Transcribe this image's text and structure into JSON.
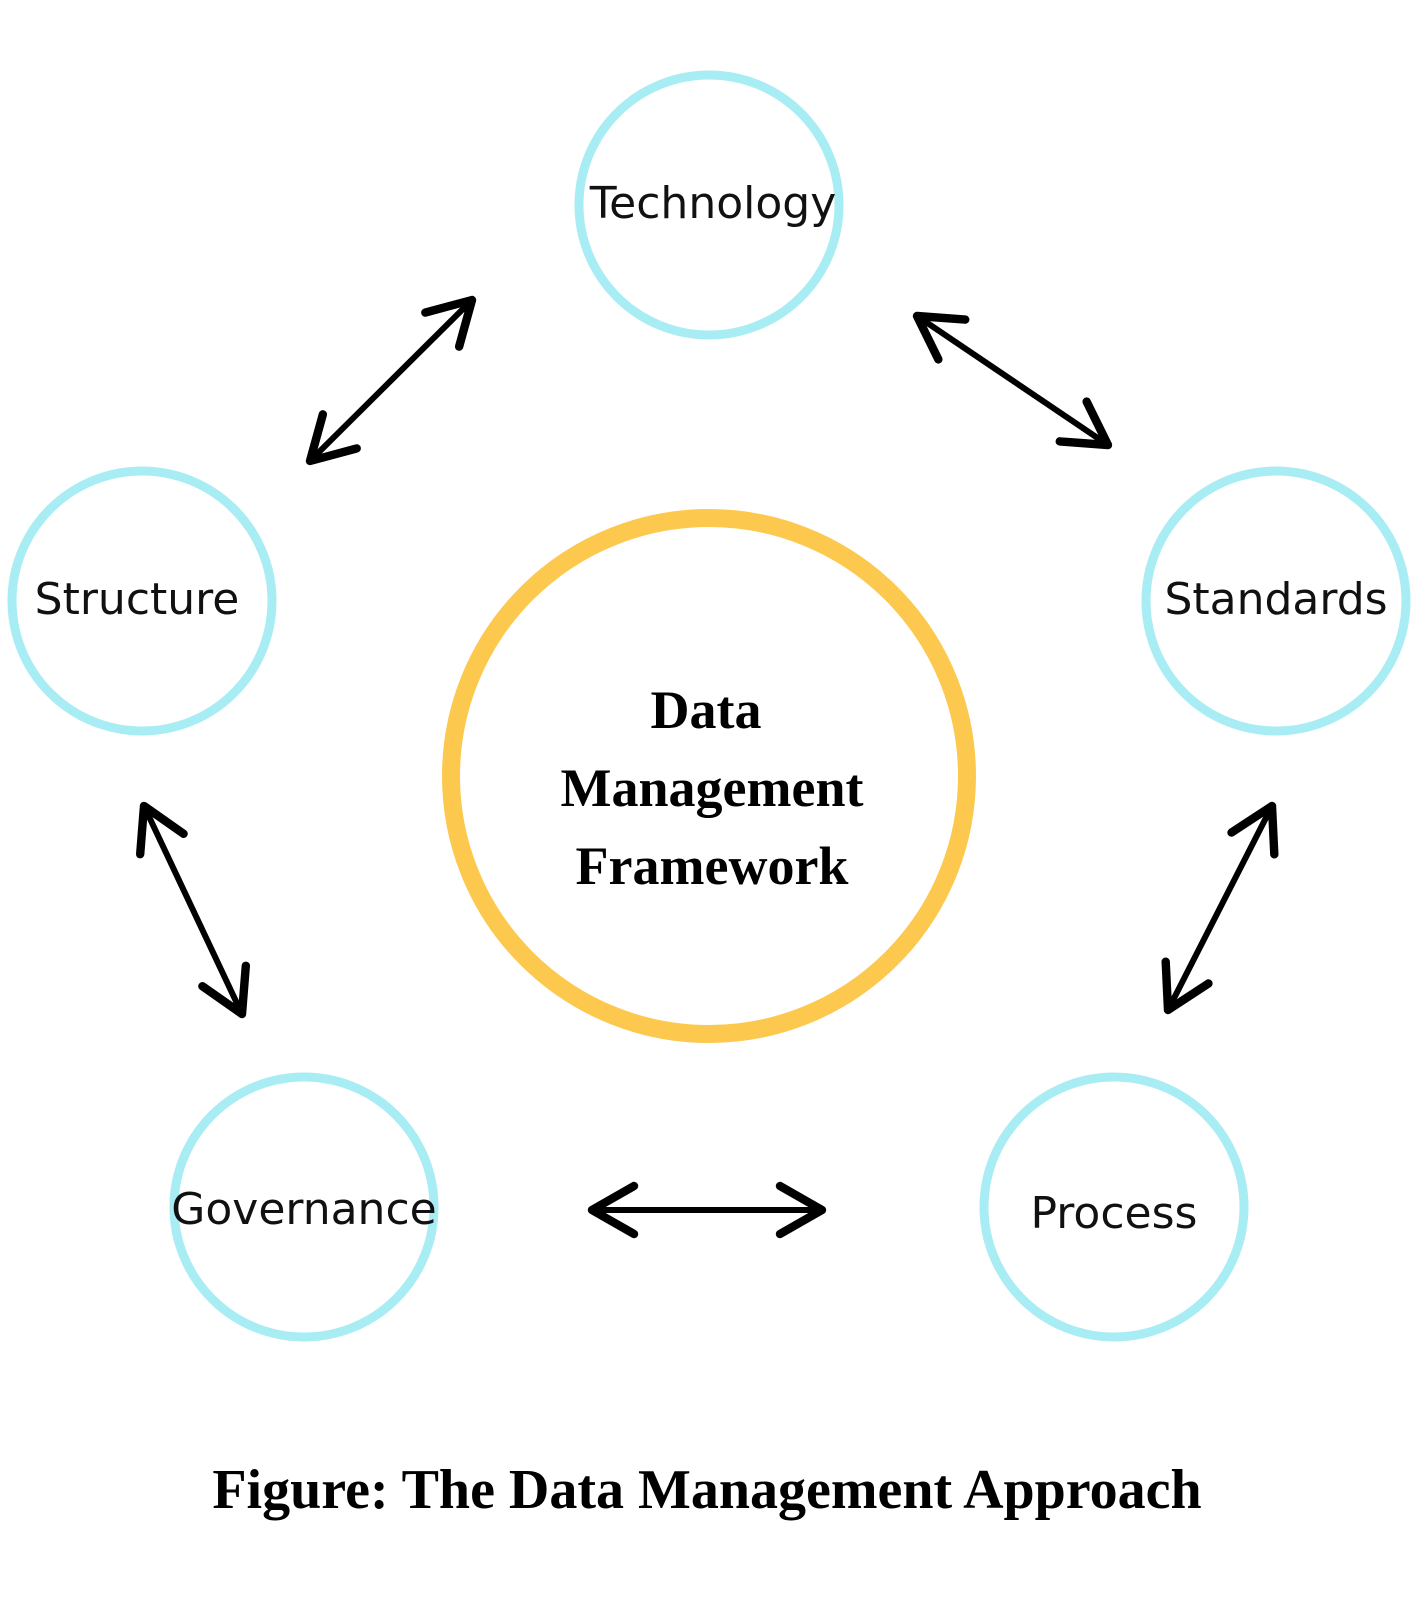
{
  "diagram": {
    "center": {
      "lines": [
        "Data",
        "Management",
        "Framework"
      ]
    },
    "nodes": [
      {
        "id": "technology",
        "label": "Technology"
      },
      {
        "id": "standards",
        "label": "Standards"
      },
      {
        "id": "process",
        "label": "Process"
      },
      {
        "id": "governance",
        "label": "Governance"
      },
      {
        "id": "structure",
        "label": "Structure"
      }
    ],
    "connections": [
      {
        "from": "structure",
        "to": "technology",
        "type": "bidirectional"
      },
      {
        "from": "technology",
        "to": "standards",
        "type": "bidirectional"
      },
      {
        "from": "standards",
        "to": "process",
        "type": "bidirectional"
      },
      {
        "from": "governance",
        "to": "process",
        "type": "bidirectional"
      },
      {
        "from": "structure",
        "to": "governance",
        "type": "bidirectional"
      }
    ],
    "colors": {
      "node_ring": "#a8ecf4",
      "center_ring": "#fcc94e",
      "arrow": "#000000"
    }
  },
  "caption": "Figure: The Data Management Approach"
}
